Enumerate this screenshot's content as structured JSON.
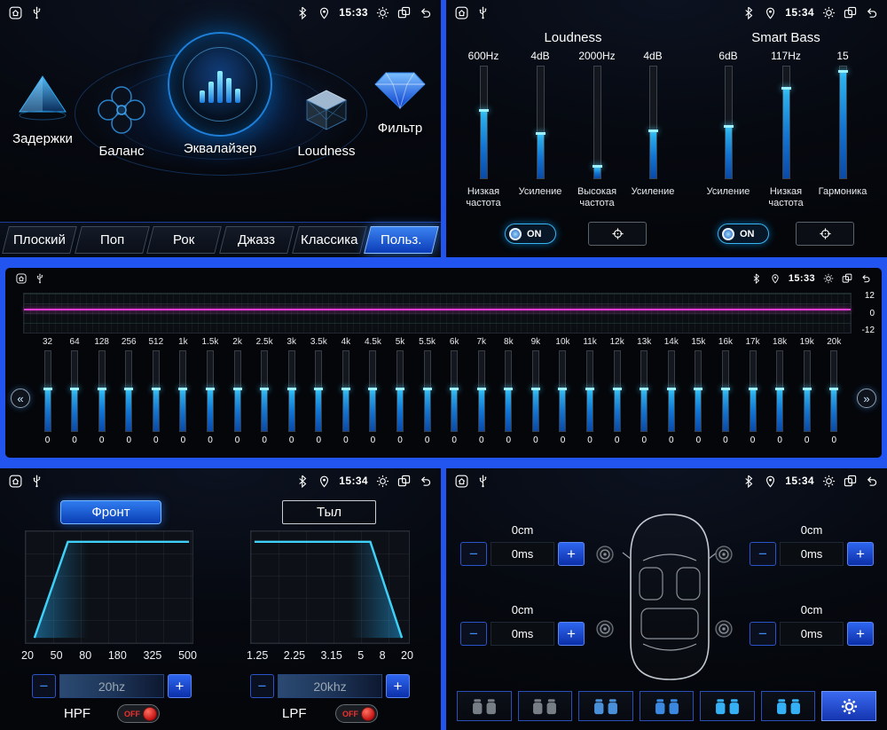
{
  "status": {
    "times": {
      "p1": "15:33",
      "p2": "15:34",
      "mid": "15:33",
      "p4": "15:34",
      "p5": "15:34"
    }
  },
  "symbols": {
    "minus": "−",
    "plus": "+",
    "chev_left": "«",
    "chev_right": "»"
  },
  "menu": {
    "items": [
      {
        "label": "Задержки"
      },
      {
        "label": "Баланс"
      },
      {
        "label": "Эквалайзер"
      },
      {
        "label": "Loudness"
      },
      {
        "label": "Фильтр"
      }
    ],
    "presets": [
      {
        "label": "Плоский",
        "active": false
      },
      {
        "label": "Поп",
        "active": false
      },
      {
        "label": "Рок",
        "active": false
      },
      {
        "label": "Джазз",
        "active": false
      },
      {
        "label": "Классика",
        "active": false
      },
      {
        "label": "Польз.",
        "active": true
      }
    ]
  },
  "loudness": {
    "section_left": "Loudness",
    "section_right": "Smart Bass",
    "sliders": [
      {
        "value": "600Hz",
        "label": "Низкая частота",
        "fill": "60%"
      },
      {
        "value": "4dB",
        "label": "Усиление",
        "fill": "40%"
      },
      {
        "value": "2000Hz",
        "label": "Высокая частота",
        "fill": "10%"
      },
      {
        "value": "4dB",
        "label": "Усиление",
        "fill": "42%"
      },
      {
        "value": "6dB",
        "label": "Усиление",
        "fill": "46%"
      },
      {
        "value": "117Hz",
        "label": "Низкая частота",
        "fill": "80%"
      },
      {
        "value": "15",
        "label": "Гармоника",
        "fill": "95%"
      }
    ],
    "toggle_on": "ON"
  },
  "eq": {
    "scale": [
      "12",
      "0",
      "-12"
    ],
    "bands": [
      {
        "freq": "32",
        "value": "0"
      },
      {
        "freq": "64",
        "value": "0"
      },
      {
        "freq": "128",
        "value": "0"
      },
      {
        "freq": "256",
        "value": "0"
      },
      {
        "freq": "512",
        "value": "0"
      },
      {
        "freq": "1k",
        "value": "0"
      },
      {
        "freq": "1.5k",
        "value": "0"
      },
      {
        "freq": "2k",
        "value": "0"
      },
      {
        "freq": "2.5k",
        "value": "0"
      },
      {
        "freq": "3k",
        "value": "0"
      },
      {
        "freq": "3.5k",
        "value": "0"
      },
      {
        "freq": "4k",
        "value": "0"
      },
      {
        "freq": "4.5k",
        "value": "0"
      },
      {
        "freq": "5k",
        "value": "0"
      },
      {
        "freq": "5.5k",
        "value": "0"
      },
      {
        "freq": "6k",
        "value": "0"
      },
      {
        "freq": "7k",
        "value": "0"
      },
      {
        "freq": "8k",
        "value": "0"
      },
      {
        "freq": "9k",
        "value": "0"
      },
      {
        "freq": "10k",
        "value": "0"
      },
      {
        "freq": "11k",
        "value": "0"
      },
      {
        "freq": "12k",
        "value": "0"
      },
      {
        "freq": "13k",
        "value": "0"
      },
      {
        "freq": "14k",
        "value": "0"
      },
      {
        "freq": "15k",
        "value": "0"
      },
      {
        "freq": "16k",
        "value": "0"
      },
      {
        "freq": "17k",
        "value": "0"
      },
      {
        "freq": "18k",
        "value": "0"
      },
      {
        "freq": "19k",
        "value": "0"
      },
      {
        "freq": "20k",
        "value": "0"
      }
    ]
  },
  "filter": {
    "tabs": [
      {
        "label": "Фронт"
      },
      {
        "label": "Тыл"
      }
    ],
    "hpf": {
      "label": "HPF",
      "value": "20hz",
      "axis": [
        "20",
        "50",
        "80",
        "180",
        "325",
        "500"
      ],
      "state": "OFF"
    },
    "lpf": {
      "label": "LPF",
      "value": "20khz",
      "axis": [
        "1.25",
        "2.25",
        "3.15",
        "5",
        "8",
        "20"
      ],
      "state": "OFF"
    }
  },
  "delays": {
    "corners": [
      {
        "cm": "0cm",
        "ms": "0ms"
      },
      {
        "cm": "0cm",
        "ms": "0ms"
      },
      {
        "cm": "0cm",
        "ms": "0ms"
      },
      {
        "cm": "0cm",
        "ms": "0ms"
      }
    ]
  },
  "colors": {
    "accent": "#35c8f5",
    "frame": "#2254f0",
    "eq_line": "#e23ed2",
    "off_red": "#f03030"
  }
}
